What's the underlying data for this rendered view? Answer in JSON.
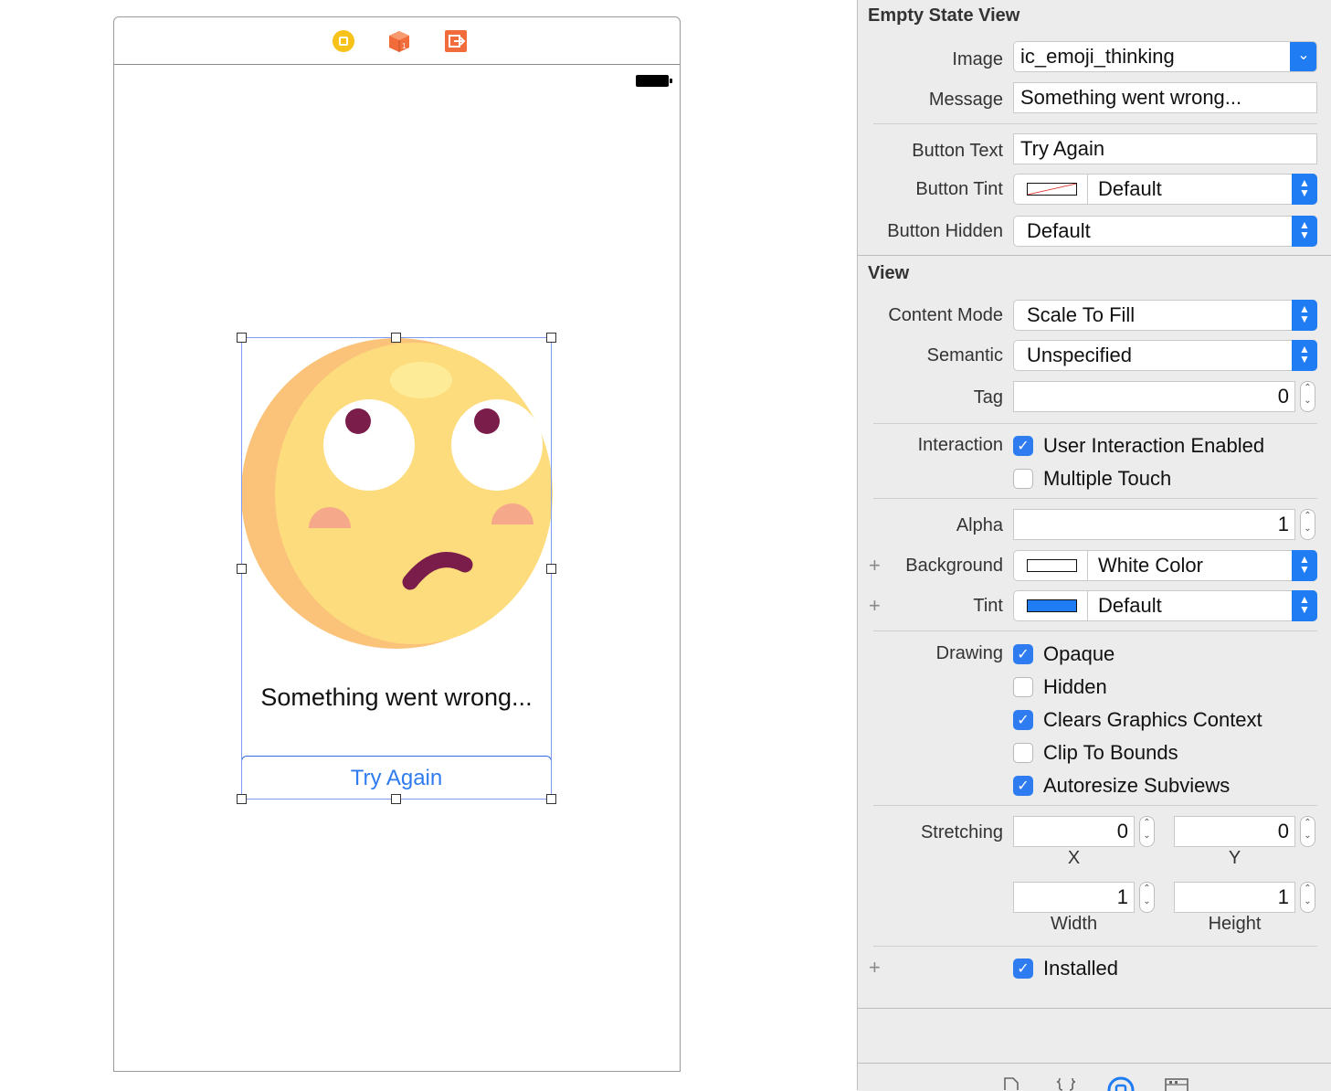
{
  "canvas": {
    "message": "Something went wrong...",
    "button_text": "Try Again"
  },
  "inspector": {
    "empty_state": {
      "title": "Empty State View",
      "image_label": "Image",
      "image_value": "ic_emoji_thinking",
      "message_label": "Message",
      "message_value": "Something went wrong...",
      "button_text_label": "Button Text",
      "button_text_value": "Try Again",
      "button_tint_label": "Button Tint",
      "button_tint_value": "Default",
      "button_hidden_label": "Button Hidden",
      "button_hidden_value": "Default"
    },
    "view": {
      "title": "View",
      "content_mode_label": "Content Mode",
      "content_mode_value": "Scale To Fill",
      "semantic_label": "Semantic",
      "semantic_value": "Unspecified",
      "tag_label": "Tag",
      "tag_value": "0",
      "interaction_label": "Interaction",
      "user_interaction_label": "User Interaction Enabled",
      "user_interaction_checked": true,
      "multiple_touch_label": "Multiple Touch",
      "multiple_touch_checked": false,
      "alpha_label": "Alpha",
      "alpha_value": "1",
      "background_label": "Background",
      "background_value": "White Color",
      "background_color": "#ffffff",
      "tint_label": "Tint",
      "tint_value": "Default",
      "tint_color": "#1f7cf2",
      "drawing_label": "Drawing",
      "opaque_label": "Opaque",
      "hidden_label": "Hidden",
      "clears_graphics_label": "Clears Graphics Context",
      "clip_to_bounds_label": "Clip To Bounds",
      "autoresize_label": "Autoresize Subviews",
      "stretching_label": "Stretching",
      "stretch_x_value": "0",
      "stretch_y_value": "0",
      "stretch_x_caption": "X",
      "stretch_y_caption": "Y",
      "stretch_width_value": "1",
      "stretch_height_value": "1",
      "stretch_width_caption": "Width",
      "stretch_height_caption": "Height",
      "installed_label": "Installed"
    }
  }
}
